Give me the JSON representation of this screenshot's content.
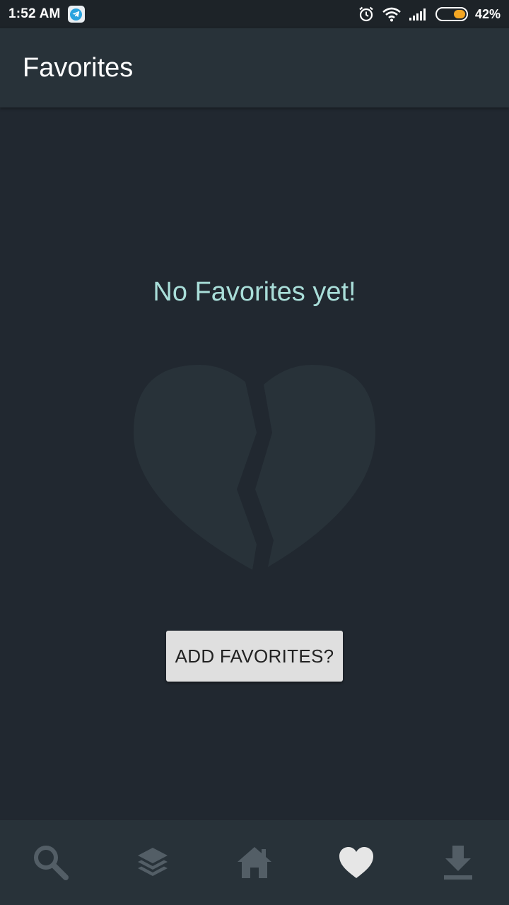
{
  "status_bar": {
    "time": "1:52 AM",
    "battery_percent": "42%",
    "battery_level": 0.42,
    "icons": [
      "telegram-icon",
      "alarm-icon",
      "wifi-icon",
      "signal-icon",
      "battery-icon"
    ]
  },
  "app_bar": {
    "title": "Favorites"
  },
  "main": {
    "empty_message": "No Favorites yet!",
    "illustration": "broken-heart-icon",
    "add_button_label": "ADD FAVORITES?"
  },
  "bottom_nav": {
    "items": [
      {
        "icon": "search-icon",
        "active": false
      },
      {
        "icon": "layers-icon",
        "active": false
      },
      {
        "icon": "home-icon",
        "active": false
      },
      {
        "icon": "heart-icon",
        "active": true
      },
      {
        "icon": "download-icon",
        "active": false
      }
    ]
  },
  "colors": {
    "background": "#212830",
    "app_bar": "#283239",
    "accent_text": "#a9ded9",
    "inactive_icon": "#535e66",
    "active_icon": "#e6e6e6",
    "battery_fill": "#f3a623"
  }
}
